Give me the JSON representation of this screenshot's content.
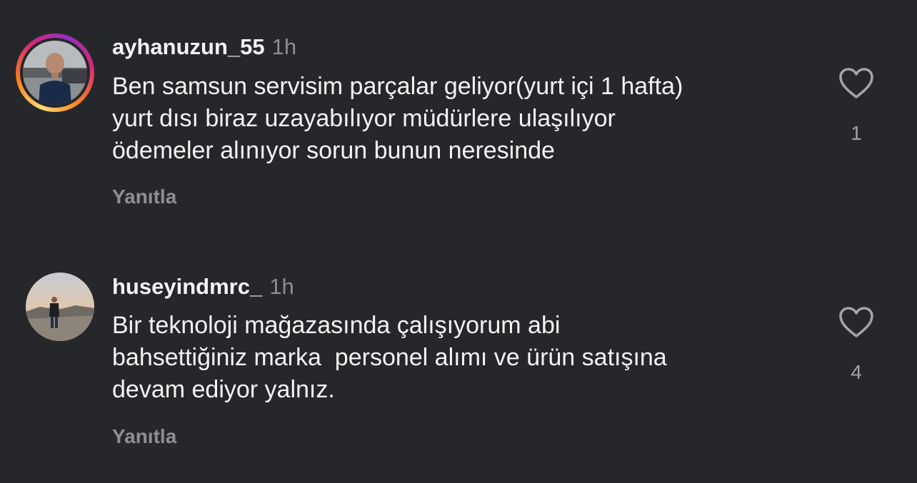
{
  "comments": [
    {
      "username": "ayhanuzun_55",
      "time": "1h",
      "text": "Ben samsun servisim parçalar geliyor(yurt içi 1 hafta)\nyurt dısı biraz uzayabılıyor müdürlere ulaşılıyor\nödemeler alınıyor sorun bunun neresinde",
      "reply_label": "Yanıtla",
      "like_count": "1",
      "has_story_ring": true
    },
    {
      "username": "huseyindmrc_",
      "time": "1h",
      "text": "Bir teknoloji mağazasında çalışıyorum abi\nbahsettiğiniz marka  personel alımı ve ürün satışına\ndevam ediyor yalnız.",
      "reply_label": "Yanıtla",
      "like_count": "4",
      "has_story_ring": false
    }
  ],
  "icons": {
    "like": "heart-outline-icon"
  },
  "colors": {
    "background": "#25272b",
    "primary_text": "#f5f5f5",
    "secondary_text": "#8e8f93"
  }
}
